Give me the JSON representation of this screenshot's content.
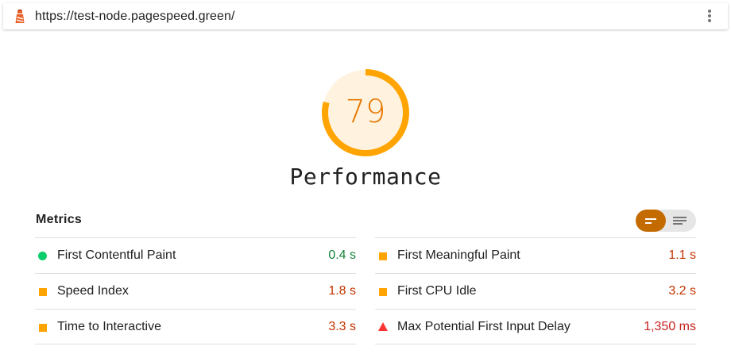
{
  "url_bar": {
    "url": "https://test-node.pagespeed.green/",
    "icon": "lighthouse-icon",
    "menu_icon": "kebab-menu-icon"
  },
  "gauge": {
    "score": "79",
    "score_fraction": 0.79,
    "label": "Performance",
    "color": "#e67700",
    "ring_color": "#ffa400",
    "bg_color": "#fff3e0"
  },
  "metrics": {
    "title": "Metrics",
    "toggle": {
      "active": "summary",
      "icons": [
        "summary-view-icon",
        "detail-view-icon"
      ]
    },
    "left": [
      {
        "name": "First Contentful Paint",
        "value": "0.4 s",
        "status": "pass",
        "indicator": "circle",
        "color": "#0cce6b",
        "value_color": "#178239"
      },
      {
        "name": "Speed Index",
        "value": "1.8 s",
        "status": "average",
        "indicator": "square",
        "color": "#ffa400",
        "value_color": "#c33300"
      },
      {
        "name": "Time to Interactive",
        "value": "3.3 s",
        "status": "average",
        "indicator": "square",
        "color": "#ffa400",
        "value_color": "#c33300"
      }
    ],
    "right": [
      {
        "name": "First Meaningful Paint",
        "value": "1.1 s",
        "status": "average",
        "indicator": "square",
        "color": "#ffa400",
        "value_color": "#c33300"
      },
      {
        "name": "First CPU Idle",
        "value": "3.2 s",
        "status": "average",
        "indicator": "square",
        "color": "#ffa400",
        "value_color": "#c33300"
      },
      {
        "name": "Max Potential First Input Delay",
        "value": "1,350 ms",
        "status": "fail",
        "indicator": "triangle",
        "color": "#f33",
        "value_color": "#c7221f"
      }
    ]
  }
}
